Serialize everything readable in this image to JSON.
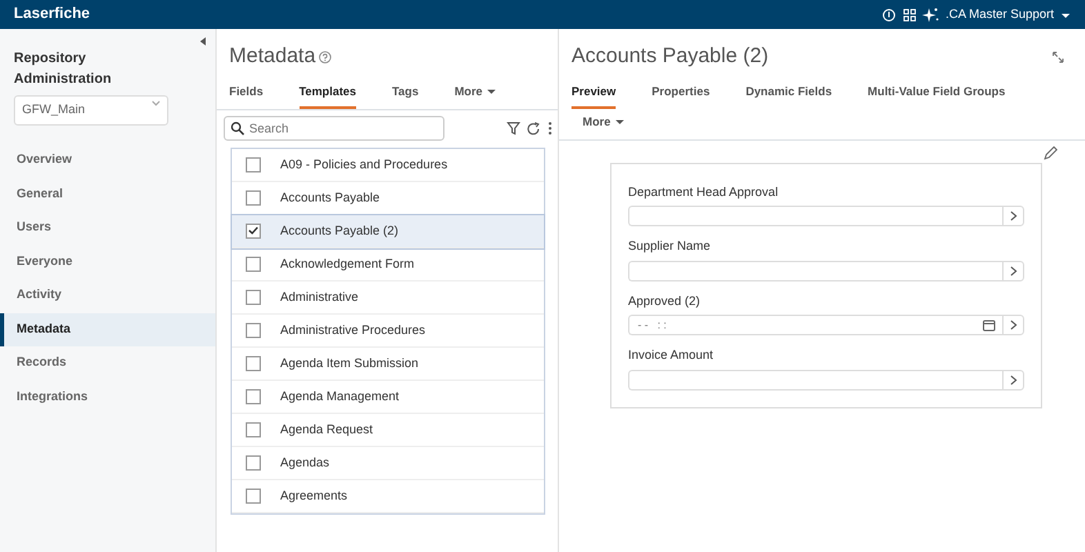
{
  "topbar": {
    "brand": "Laserfiche",
    "user": ".CA Master Support"
  },
  "sidebar": {
    "title": "Repository Administration",
    "repository": "GFW_Main",
    "items": [
      {
        "label": "Overview",
        "selected": false
      },
      {
        "label": "General",
        "selected": false
      },
      {
        "label": "Users",
        "selected": false
      },
      {
        "label": "Everyone",
        "selected": false
      },
      {
        "label": "Activity",
        "selected": false
      },
      {
        "label": "Metadata",
        "selected": true
      },
      {
        "label": "Records",
        "selected": false
      },
      {
        "label": "Integrations",
        "selected": false
      }
    ]
  },
  "metadata": {
    "title": "Metadata",
    "tabs": [
      {
        "label": "Fields",
        "selected": false,
        "dropdown": false
      },
      {
        "label": "Templates",
        "selected": true,
        "dropdown": false
      },
      {
        "label": "Tags",
        "selected": false,
        "dropdown": false
      },
      {
        "label": "More",
        "selected": false,
        "dropdown": true
      }
    ],
    "search": {
      "placeholder": "Search"
    },
    "templates": [
      {
        "name": "A09 - Policies and Procedures",
        "checked": false,
        "selected": false
      },
      {
        "name": "Accounts Payable",
        "checked": false,
        "selected": false
      },
      {
        "name": "Accounts Payable (2)",
        "checked": true,
        "selected": true
      },
      {
        "name": "Acknowledgement Form",
        "checked": false,
        "selected": false
      },
      {
        "name": "Administrative",
        "checked": false,
        "selected": false
      },
      {
        "name": "Administrative Procedures",
        "checked": false,
        "selected": false
      },
      {
        "name": "Agenda Item Submission",
        "checked": false,
        "selected": false
      },
      {
        "name": "Agenda Management",
        "checked": false,
        "selected": false
      },
      {
        "name": "Agenda Request",
        "checked": false,
        "selected": false
      },
      {
        "name": "Agendas",
        "checked": false,
        "selected": false
      },
      {
        "name": "Agreements",
        "checked": false,
        "selected": false
      }
    ]
  },
  "detail": {
    "title": "Accounts Payable (2)",
    "tabs": [
      {
        "label": "Preview",
        "selected": true,
        "dropdown": false
      },
      {
        "label": "Properties",
        "selected": false,
        "dropdown": false
      },
      {
        "label": "Dynamic Fields",
        "selected": false,
        "dropdown": false
      },
      {
        "label": "Multi-Value Field Groups",
        "selected": false,
        "dropdown": false
      },
      {
        "label": "More",
        "selected": false,
        "dropdown": true
      }
    ],
    "fields": [
      {
        "label": "Department Head Approval",
        "kind": "text"
      },
      {
        "label": "Supplier Name",
        "kind": "text"
      },
      {
        "label": "Approved (2)",
        "kind": "date",
        "placeholder": "- -   : :"
      },
      {
        "label": "Invoice Amount",
        "kind": "text"
      }
    ]
  }
}
